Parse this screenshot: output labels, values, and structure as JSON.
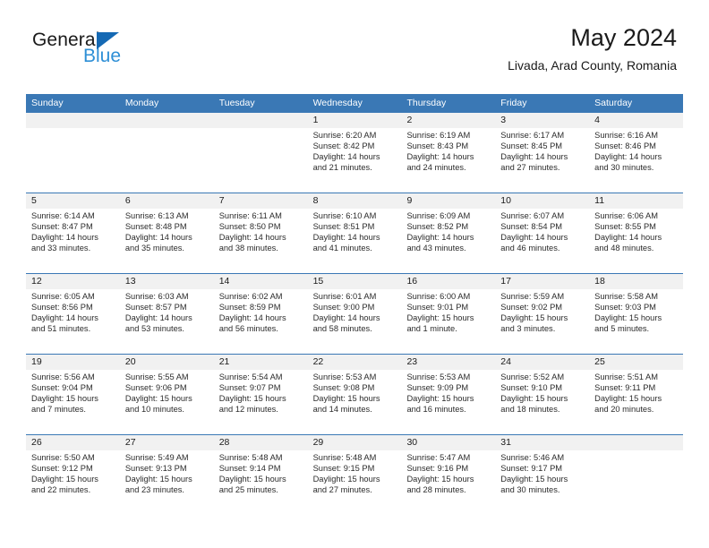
{
  "brand": {
    "name_part1": "General",
    "name_part2": "Blue",
    "triangle_icon": "blue-triangle-icon",
    "colors": {
      "dark": "#1a1a1a",
      "blue": "#2e8fd6",
      "triangle": "#1569b4"
    }
  },
  "header": {
    "title": "May 2024",
    "subtitle": "Livada, Arad County, Romania"
  },
  "colors": {
    "header_row_bg": "#3a78b5",
    "daynum_band_bg": "#f1f1f1",
    "grid_line": "#3a78b5",
    "text": "#1a1a1a"
  },
  "weekdays": [
    "Sunday",
    "Monday",
    "Tuesday",
    "Wednesday",
    "Thursday",
    "Friday",
    "Saturday"
  ],
  "weeks": [
    {
      "days": [
        {
          "num": "",
          "sunrise": "",
          "sunset": "",
          "daylight1": "",
          "daylight2": ""
        },
        {
          "num": "",
          "sunrise": "",
          "sunset": "",
          "daylight1": "",
          "daylight2": ""
        },
        {
          "num": "",
          "sunrise": "",
          "sunset": "",
          "daylight1": "",
          "daylight2": ""
        },
        {
          "num": "1",
          "sunrise": "Sunrise: 6:20 AM",
          "sunset": "Sunset: 8:42 PM",
          "daylight1": "Daylight: 14 hours",
          "daylight2": "and 21 minutes."
        },
        {
          "num": "2",
          "sunrise": "Sunrise: 6:19 AM",
          "sunset": "Sunset: 8:43 PM",
          "daylight1": "Daylight: 14 hours",
          "daylight2": "and 24 minutes."
        },
        {
          "num": "3",
          "sunrise": "Sunrise: 6:17 AM",
          "sunset": "Sunset: 8:45 PM",
          "daylight1": "Daylight: 14 hours",
          "daylight2": "and 27 minutes."
        },
        {
          "num": "4",
          "sunrise": "Sunrise: 6:16 AM",
          "sunset": "Sunset: 8:46 PM",
          "daylight1": "Daylight: 14 hours",
          "daylight2": "and 30 minutes."
        }
      ]
    },
    {
      "days": [
        {
          "num": "5",
          "sunrise": "Sunrise: 6:14 AM",
          "sunset": "Sunset: 8:47 PM",
          "daylight1": "Daylight: 14 hours",
          "daylight2": "and 33 minutes."
        },
        {
          "num": "6",
          "sunrise": "Sunrise: 6:13 AM",
          "sunset": "Sunset: 8:48 PM",
          "daylight1": "Daylight: 14 hours",
          "daylight2": "and 35 minutes."
        },
        {
          "num": "7",
          "sunrise": "Sunrise: 6:11 AM",
          "sunset": "Sunset: 8:50 PM",
          "daylight1": "Daylight: 14 hours",
          "daylight2": "and 38 minutes."
        },
        {
          "num": "8",
          "sunrise": "Sunrise: 6:10 AM",
          "sunset": "Sunset: 8:51 PM",
          "daylight1": "Daylight: 14 hours",
          "daylight2": "and 41 minutes."
        },
        {
          "num": "9",
          "sunrise": "Sunrise: 6:09 AM",
          "sunset": "Sunset: 8:52 PM",
          "daylight1": "Daylight: 14 hours",
          "daylight2": "and 43 minutes."
        },
        {
          "num": "10",
          "sunrise": "Sunrise: 6:07 AM",
          "sunset": "Sunset: 8:54 PM",
          "daylight1": "Daylight: 14 hours",
          "daylight2": "and 46 minutes."
        },
        {
          "num": "11",
          "sunrise": "Sunrise: 6:06 AM",
          "sunset": "Sunset: 8:55 PM",
          "daylight1": "Daylight: 14 hours",
          "daylight2": "and 48 minutes."
        }
      ]
    },
    {
      "days": [
        {
          "num": "12",
          "sunrise": "Sunrise: 6:05 AM",
          "sunset": "Sunset: 8:56 PM",
          "daylight1": "Daylight: 14 hours",
          "daylight2": "and 51 minutes."
        },
        {
          "num": "13",
          "sunrise": "Sunrise: 6:03 AM",
          "sunset": "Sunset: 8:57 PM",
          "daylight1": "Daylight: 14 hours",
          "daylight2": "and 53 minutes."
        },
        {
          "num": "14",
          "sunrise": "Sunrise: 6:02 AM",
          "sunset": "Sunset: 8:59 PM",
          "daylight1": "Daylight: 14 hours",
          "daylight2": "and 56 minutes."
        },
        {
          "num": "15",
          "sunrise": "Sunrise: 6:01 AM",
          "sunset": "Sunset: 9:00 PM",
          "daylight1": "Daylight: 14 hours",
          "daylight2": "and 58 minutes."
        },
        {
          "num": "16",
          "sunrise": "Sunrise: 6:00 AM",
          "sunset": "Sunset: 9:01 PM",
          "daylight1": "Daylight: 15 hours",
          "daylight2": "and 1 minute."
        },
        {
          "num": "17",
          "sunrise": "Sunrise: 5:59 AM",
          "sunset": "Sunset: 9:02 PM",
          "daylight1": "Daylight: 15 hours",
          "daylight2": "and 3 minutes."
        },
        {
          "num": "18",
          "sunrise": "Sunrise: 5:58 AM",
          "sunset": "Sunset: 9:03 PM",
          "daylight1": "Daylight: 15 hours",
          "daylight2": "and 5 minutes."
        }
      ]
    },
    {
      "days": [
        {
          "num": "19",
          "sunrise": "Sunrise: 5:56 AM",
          "sunset": "Sunset: 9:04 PM",
          "daylight1": "Daylight: 15 hours",
          "daylight2": "and 7 minutes."
        },
        {
          "num": "20",
          "sunrise": "Sunrise: 5:55 AM",
          "sunset": "Sunset: 9:06 PM",
          "daylight1": "Daylight: 15 hours",
          "daylight2": "and 10 minutes."
        },
        {
          "num": "21",
          "sunrise": "Sunrise: 5:54 AM",
          "sunset": "Sunset: 9:07 PM",
          "daylight1": "Daylight: 15 hours",
          "daylight2": "and 12 minutes."
        },
        {
          "num": "22",
          "sunrise": "Sunrise: 5:53 AM",
          "sunset": "Sunset: 9:08 PM",
          "daylight1": "Daylight: 15 hours",
          "daylight2": "and 14 minutes."
        },
        {
          "num": "23",
          "sunrise": "Sunrise: 5:53 AM",
          "sunset": "Sunset: 9:09 PM",
          "daylight1": "Daylight: 15 hours",
          "daylight2": "and 16 minutes."
        },
        {
          "num": "24",
          "sunrise": "Sunrise: 5:52 AM",
          "sunset": "Sunset: 9:10 PM",
          "daylight1": "Daylight: 15 hours",
          "daylight2": "and 18 minutes."
        },
        {
          "num": "25",
          "sunrise": "Sunrise: 5:51 AM",
          "sunset": "Sunset: 9:11 PM",
          "daylight1": "Daylight: 15 hours",
          "daylight2": "and 20 minutes."
        }
      ]
    },
    {
      "days": [
        {
          "num": "26",
          "sunrise": "Sunrise: 5:50 AM",
          "sunset": "Sunset: 9:12 PM",
          "daylight1": "Daylight: 15 hours",
          "daylight2": "and 22 minutes."
        },
        {
          "num": "27",
          "sunrise": "Sunrise: 5:49 AM",
          "sunset": "Sunset: 9:13 PM",
          "daylight1": "Daylight: 15 hours",
          "daylight2": "and 23 minutes."
        },
        {
          "num": "28",
          "sunrise": "Sunrise: 5:48 AM",
          "sunset": "Sunset: 9:14 PM",
          "daylight1": "Daylight: 15 hours",
          "daylight2": "and 25 minutes."
        },
        {
          "num": "29",
          "sunrise": "Sunrise: 5:48 AM",
          "sunset": "Sunset: 9:15 PM",
          "daylight1": "Daylight: 15 hours",
          "daylight2": "and 27 minutes."
        },
        {
          "num": "30",
          "sunrise": "Sunrise: 5:47 AM",
          "sunset": "Sunset: 9:16 PM",
          "daylight1": "Daylight: 15 hours",
          "daylight2": "and 28 minutes."
        },
        {
          "num": "31",
          "sunrise": "Sunrise: 5:46 AM",
          "sunset": "Sunset: 9:17 PM",
          "daylight1": "Daylight: 15 hours",
          "daylight2": "and 30 minutes."
        },
        {
          "num": "",
          "sunrise": "",
          "sunset": "",
          "daylight1": "",
          "daylight2": ""
        }
      ]
    }
  ]
}
